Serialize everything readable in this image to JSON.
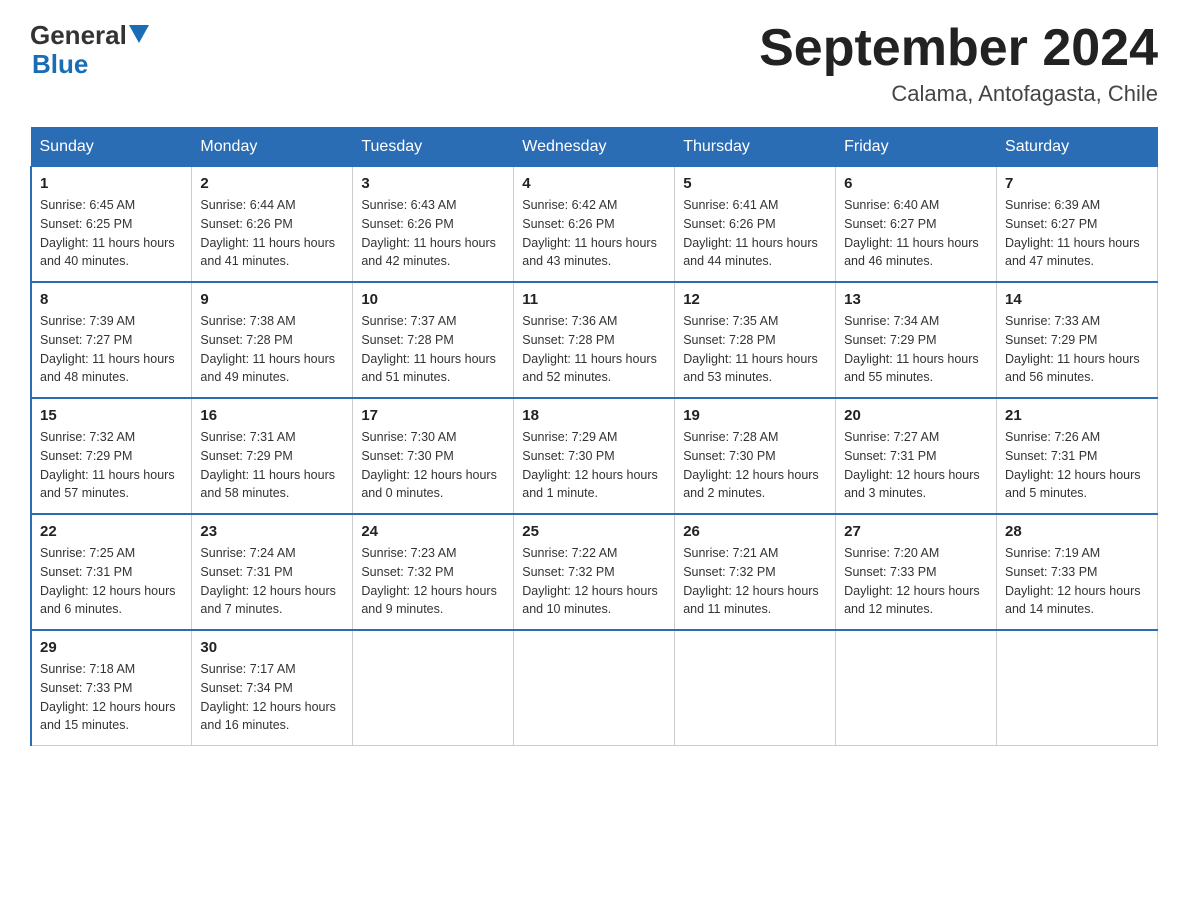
{
  "logo": {
    "general": "General",
    "blue": "Blue"
  },
  "title": "September 2024",
  "subtitle": "Calama, Antofagasta, Chile",
  "headers": [
    "Sunday",
    "Monday",
    "Tuesday",
    "Wednesday",
    "Thursday",
    "Friday",
    "Saturday"
  ],
  "weeks": [
    [
      {
        "day": "1",
        "sunrise": "6:45 AM",
        "sunset": "6:25 PM",
        "daylight": "11 hours and 40 minutes."
      },
      {
        "day": "2",
        "sunrise": "6:44 AM",
        "sunset": "6:26 PM",
        "daylight": "11 hours and 41 minutes."
      },
      {
        "day": "3",
        "sunrise": "6:43 AM",
        "sunset": "6:26 PM",
        "daylight": "11 hours and 42 minutes."
      },
      {
        "day": "4",
        "sunrise": "6:42 AM",
        "sunset": "6:26 PM",
        "daylight": "11 hours and 43 minutes."
      },
      {
        "day": "5",
        "sunrise": "6:41 AM",
        "sunset": "6:26 PM",
        "daylight": "11 hours and 44 minutes."
      },
      {
        "day": "6",
        "sunrise": "6:40 AM",
        "sunset": "6:27 PM",
        "daylight": "11 hours and 46 minutes."
      },
      {
        "day": "7",
        "sunrise": "6:39 AM",
        "sunset": "6:27 PM",
        "daylight": "11 hours and 47 minutes."
      }
    ],
    [
      {
        "day": "8",
        "sunrise": "7:39 AM",
        "sunset": "7:27 PM",
        "daylight": "11 hours and 48 minutes."
      },
      {
        "day": "9",
        "sunrise": "7:38 AM",
        "sunset": "7:28 PM",
        "daylight": "11 hours and 49 minutes."
      },
      {
        "day": "10",
        "sunrise": "7:37 AM",
        "sunset": "7:28 PM",
        "daylight": "11 hours and 51 minutes."
      },
      {
        "day": "11",
        "sunrise": "7:36 AM",
        "sunset": "7:28 PM",
        "daylight": "11 hours and 52 minutes."
      },
      {
        "day": "12",
        "sunrise": "7:35 AM",
        "sunset": "7:28 PM",
        "daylight": "11 hours and 53 minutes."
      },
      {
        "day": "13",
        "sunrise": "7:34 AM",
        "sunset": "7:29 PM",
        "daylight": "11 hours and 55 minutes."
      },
      {
        "day": "14",
        "sunrise": "7:33 AM",
        "sunset": "7:29 PM",
        "daylight": "11 hours and 56 minutes."
      }
    ],
    [
      {
        "day": "15",
        "sunrise": "7:32 AM",
        "sunset": "7:29 PM",
        "daylight": "11 hours and 57 minutes."
      },
      {
        "day": "16",
        "sunrise": "7:31 AM",
        "sunset": "7:29 PM",
        "daylight": "11 hours and 58 minutes."
      },
      {
        "day": "17",
        "sunrise": "7:30 AM",
        "sunset": "7:30 PM",
        "daylight": "12 hours and 0 minutes."
      },
      {
        "day": "18",
        "sunrise": "7:29 AM",
        "sunset": "7:30 PM",
        "daylight": "12 hours and 1 minute."
      },
      {
        "day": "19",
        "sunrise": "7:28 AM",
        "sunset": "7:30 PM",
        "daylight": "12 hours and 2 minutes."
      },
      {
        "day": "20",
        "sunrise": "7:27 AM",
        "sunset": "7:31 PM",
        "daylight": "12 hours and 3 minutes."
      },
      {
        "day": "21",
        "sunrise": "7:26 AM",
        "sunset": "7:31 PM",
        "daylight": "12 hours and 5 minutes."
      }
    ],
    [
      {
        "day": "22",
        "sunrise": "7:25 AM",
        "sunset": "7:31 PM",
        "daylight": "12 hours and 6 minutes."
      },
      {
        "day": "23",
        "sunrise": "7:24 AM",
        "sunset": "7:31 PM",
        "daylight": "12 hours and 7 minutes."
      },
      {
        "day": "24",
        "sunrise": "7:23 AM",
        "sunset": "7:32 PM",
        "daylight": "12 hours and 9 minutes."
      },
      {
        "day": "25",
        "sunrise": "7:22 AM",
        "sunset": "7:32 PM",
        "daylight": "12 hours and 10 minutes."
      },
      {
        "day": "26",
        "sunrise": "7:21 AM",
        "sunset": "7:32 PM",
        "daylight": "12 hours and 11 minutes."
      },
      {
        "day": "27",
        "sunrise": "7:20 AM",
        "sunset": "7:33 PM",
        "daylight": "12 hours and 12 minutes."
      },
      {
        "day": "28",
        "sunrise": "7:19 AM",
        "sunset": "7:33 PM",
        "daylight": "12 hours and 14 minutes."
      }
    ],
    [
      {
        "day": "29",
        "sunrise": "7:18 AM",
        "sunset": "7:33 PM",
        "daylight": "12 hours and 15 minutes."
      },
      {
        "day": "30",
        "sunrise": "7:17 AM",
        "sunset": "7:34 PM",
        "daylight": "12 hours and 16 minutes."
      },
      null,
      null,
      null,
      null,
      null
    ]
  ],
  "labels": {
    "sunrise": "Sunrise:",
    "sunset": "Sunset:",
    "daylight": "Daylight:"
  }
}
